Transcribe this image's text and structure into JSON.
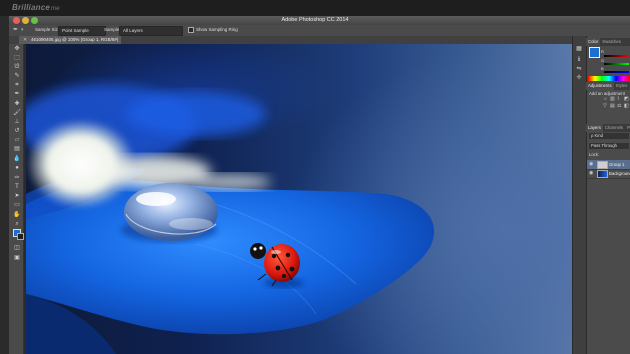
{
  "watermark": {
    "brand": "Brilliance",
    "suffix": "me"
  },
  "app": {
    "title": "Adobe Photoshop CC 2014"
  },
  "options_bar": {
    "tool_icon": "eyedropper-icon",
    "sample_size_label": "Sample Size:",
    "sample_size_value": "Point Sample",
    "sample_label": "Sample:",
    "sample_value": "All Layers",
    "show_ring_label": "Show Sampling Ring",
    "show_ring_checked": true
  },
  "document_tab": {
    "title": "461090405.jpg @ 100% (Group 1, RGB/8#) *"
  },
  "tools": [
    "move-icon",
    "marquee-icon",
    "lasso-icon",
    "quick-select-icon",
    "crop-icon",
    "eyedropper-icon",
    "spot-heal-icon",
    "brush-icon",
    "stamp-icon",
    "history-brush-icon",
    "eraser-icon",
    "gradient-icon",
    "blur-icon",
    "dodge-icon",
    "pen-icon",
    "type-icon",
    "path-select-icon",
    "shape-icon",
    "hand-icon",
    "zoom-icon"
  ],
  "colors": {
    "foreground": "#1b6fd0",
    "background": "#222222",
    "accent": "#1b6fd0"
  },
  "panels": {
    "color_tabs": [
      "Color",
      "Swatches"
    ],
    "color_sliders": [
      "R",
      "G",
      "B"
    ],
    "adjustments_tabs": [
      "Adjustments",
      "Styles"
    ],
    "adjustments_label": "Add an adjustment",
    "layers_tabs": [
      "Layers",
      "Channels",
      "Pa"
    ],
    "kind_label": "ρ Kind",
    "blend_mode": "Pass Through",
    "lock_label": "Lock:",
    "layers": [
      {
        "name": "Group 1",
        "selected": true
      },
      {
        "name": "Background",
        "selected": false
      }
    ]
  }
}
